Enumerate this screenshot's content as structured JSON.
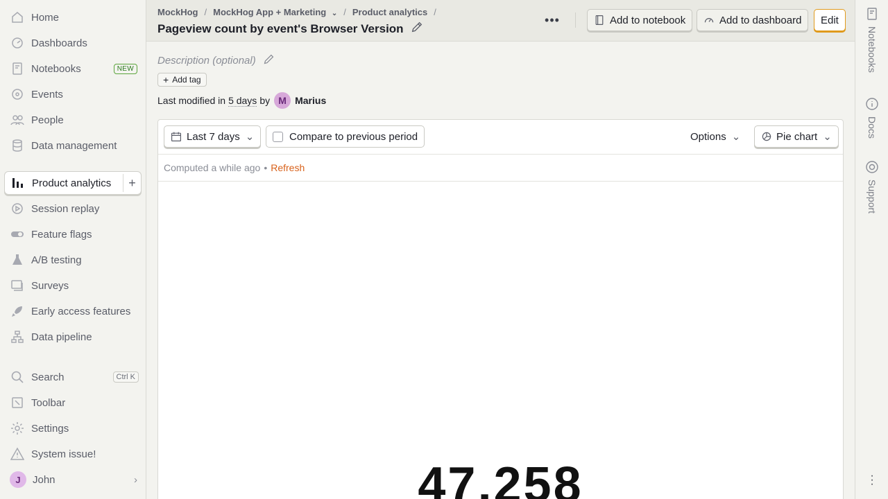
{
  "sidebar": {
    "items": [
      {
        "label": "Home",
        "icon": "home-icon"
      },
      {
        "label": "Dashboards",
        "icon": "dashboard-icon"
      },
      {
        "label": "Notebooks",
        "icon": "notebook-icon",
        "badge": "NEW"
      },
      {
        "label": "Events",
        "icon": "events-icon"
      },
      {
        "label": "People",
        "icon": "people-icon"
      },
      {
        "label": "Data management",
        "icon": "database-icon"
      },
      {
        "label": "Product analytics",
        "icon": "bar-chart-icon"
      },
      {
        "label": "Session replay",
        "icon": "replay-icon"
      },
      {
        "label": "Feature flags",
        "icon": "toggle-icon"
      },
      {
        "label": "A/B testing",
        "icon": "flask-icon"
      },
      {
        "label": "Surveys",
        "icon": "survey-icon"
      },
      {
        "label": "Early access features",
        "icon": "rocket-icon"
      },
      {
        "label": "Data pipeline",
        "icon": "pipeline-icon"
      }
    ],
    "search": {
      "label": "Search",
      "shortcut": "Ctrl K"
    },
    "toolbar": {
      "label": "Toolbar"
    },
    "settings": {
      "label": "Settings"
    },
    "system_issue": {
      "label": "System issue!"
    },
    "user": {
      "initial": "J",
      "name": "John"
    }
  },
  "rail": {
    "notebooks": "Notebooks",
    "docs": "Docs",
    "support": "Support"
  },
  "header": {
    "breadcrumbs": [
      "MockHog",
      "MockHog App + Marketing",
      "Product analytics"
    ],
    "separator": "/",
    "title": "Pageview count by event's Browser Version",
    "add_to_notebook": "Add to notebook",
    "add_to_dashboard": "Add to dashboard",
    "edit": "Edit"
  },
  "insight": {
    "description_placeholder": "Description (optional)",
    "add_tag": "Add tag",
    "modified_prefix": "Last modified in",
    "modified_when": "5 days",
    "modified_by": "by",
    "author_initial": "M",
    "author_name": "Marius"
  },
  "toolbar": {
    "date_range": "Last 7 days",
    "compare_label": "Compare to previous period",
    "compare_checked": false,
    "options": "Options",
    "chart_type": "Pie chart"
  },
  "status": {
    "computed": "Computed a while ago",
    "bullet": "•",
    "refresh": "Refresh"
  },
  "result": {
    "total": "47,258"
  },
  "colors": {
    "accent_orange": "#d8611a",
    "edit_border": "#e09a1c",
    "badge_green": "#2b7a1e"
  }
}
